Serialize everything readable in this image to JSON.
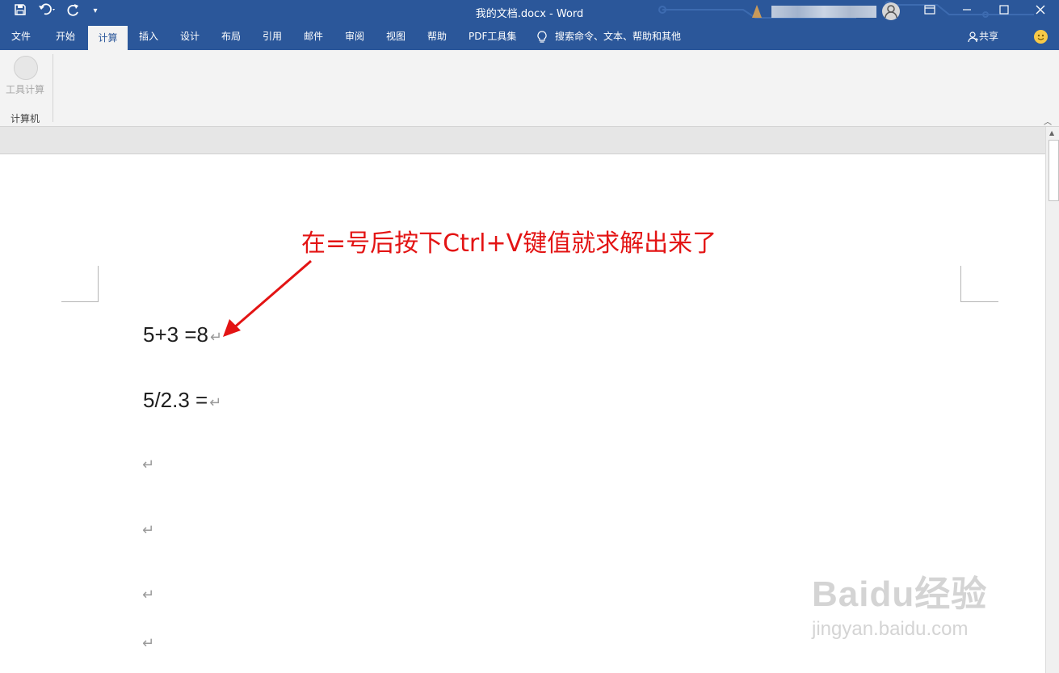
{
  "titlebar": {
    "title": "我的文档.docx  -  Word",
    "icons": [
      "save-icon",
      "undo-icon",
      "redo-icon",
      "customize-qat-icon"
    ],
    "controls": [
      "ribbon-display-icon",
      "minimize-icon",
      "maximize-icon",
      "close-icon"
    ]
  },
  "tabs": [
    {
      "label": "文件"
    },
    {
      "label": "开始"
    },
    {
      "label": "计算",
      "active": true
    },
    {
      "label": "插入"
    },
    {
      "label": "设计"
    },
    {
      "label": "布局"
    },
    {
      "label": "引用"
    },
    {
      "label": "邮件"
    },
    {
      "label": "审阅"
    },
    {
      "label": "视图"
    },
    {
      "label": "帮助"
    },
    {
      "label": "PDF工具集"
    }
  ],
  "tell_me": "搜索命令、文本、帮助和其他",
  "share": "共享",
  "ribbon": {
    "button_label": "工具计算",
    "group_label": "计算机"
  },
  "document": {
    "lines": [
      "5+3 =8",
      "5/2.3 ="
    ],
    "paragraph_mark": "↵"
  },
  "annotation": "在=号后按下Ctrl+V键值就求解出来了",
  "watermark": {
    "logo": "Baidu经验",
    "url": "jingyan.baidu.com"
  },
  "colors": {
    "title_bar": "#2b579a",
    "annotation": "#e31414",
    "ribbon_bg": "#f3f3f3"
  }
}
